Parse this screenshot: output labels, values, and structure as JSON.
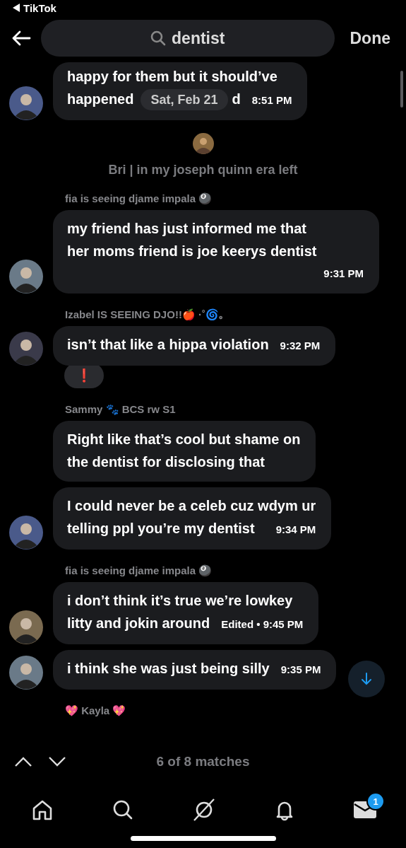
{
  "status_bar": {
    "back_app": "TikTok"
  },
  "header": {
    "search": {
      "value": "dentist"
    },
    "done": "Done"
  },
  "chat": [
    {
      "kind": "covered",
      "avatar": true,
      "lines": [
        "happy for them but it should’ve",
        "happened"
      ],
      "text_after": "d",
      "date": "Sat, Feb 21",
      "time": "8:51 PM"
    },
    {
      "kind": "system",
      "text": "Bri | in my joseph quinn era left"
    },
    {
      "kind": "sender",
      "text": "fia is seeing djame impala 🎱"
    },
    {
      "kind": "message",
      "avatar": true,
      "lines": [
        "my friend has just informed me that",
        "her moms friend is joe keerys dentist"
      ],
      "time": "9:31 PM"
    },
    {
      "kind": "sender",
      "text": "Izabel IS SEEING DJO!!🍎 ·˚🌀｡"
    },
    {
      "kind": "message",
      "avatar": true,
      "lines": [
        "isn’t that like a hippa violation"
      ],
      "time": "9:32 PM",
      "reaction": "❗"
    },
    {
      "kind": "sender",
      "text": "Sammy 🐾 BCS rw S1"
    },
    {
      "kind": "message",
      "avatar": false,
      "lines": [
        "Right like that’s cool but shame on",
        "the dentist for disclosing that"
      ]
    },
    {
      "kind": "message",
      "avatar": true,
      "lines": [
        "I could never be a celeb cuz wdym ur",
        "telling ppl you’re my dentist"
      ],
      "time": "9:34 PM"
    },
    {
      "kind": "sender",
      "text": "fia is seeing djame impala 🎱"
    },
    {
      "kind": "message",
      "avatar": true,
      "lines": [
        "i don’t think it’s true we’re lowkey",
        "litty and jokin around"
      ],
      "time": "Edited • 9:45 PM"
    },
    {
      "kind": "message",
      "avatar": true,
      "lines": [
        "i think she was just being silly"
      ],
      "time": "9:35 PM"
    },
    {
      "kind": "sender",
      "text": "💖 Kayla 💖"
    }
  ],
  "matches": "6 of 8 matches",
  "nav": [
    {
      "kind": "home",
      "selected": false
    },
    {
      "kind": "search",
      "selected": false
    },
    {
      "kind": "grok",
      "selected": false
    },
    {
      "kind": "bell",
      "selected": false
    },
    {
      "kind": "mail",
      "selected": true,
      "badge": "1"
    }
  ]
}
